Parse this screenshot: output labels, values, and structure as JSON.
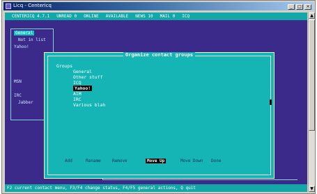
{
  "window": {
    "title": "Licq - Centericq"
  },
  "menubar": {
    "items": [
      "CENTERICQ 4.7.1",
      "UNREAD 0",
      "ONLINE",
      "AVAILABLE",
      "NEWS 10",
      "MAIL 0",
      "ICQ"
    ]
  },
  "tree": {
    "lines": [
      "General",
      "Not in list",
      "Yahoo!",
      "",
      "",
      "",
      "",
      "MSN",
      "",
      "IRC",
      "Jabber"
    ],
    "selected_index": 0
  },
  "dialog": {
    "title": "Organize contact groups",
    "root": "Groups",
    "groups": [
      "General",
      "Other stuff",
      "ICQ",
      "Yahoo!",
      "AIM",
      "IRC",
      "Various blah"
    ],
    "selected_index": 3,
    "buttons": [
      "Add",
      "Rename",
      "Remove",
      "Move Up",
      "Move Down",
      "Done"
    ],
    "active_button_index": 3
  },
  "statusbar": {
    "text": "F2 current contact menu, F3/F4 change status, F4/F5 general actions, Q quit"
  },
  "colors": {
    "terminal_bg": "#3b2a8a",
    "menubar_bg": "#13a7a7",
    "dialog_bg": "#16b5b5",
    "selected_bg": "#000000"
  }
}
